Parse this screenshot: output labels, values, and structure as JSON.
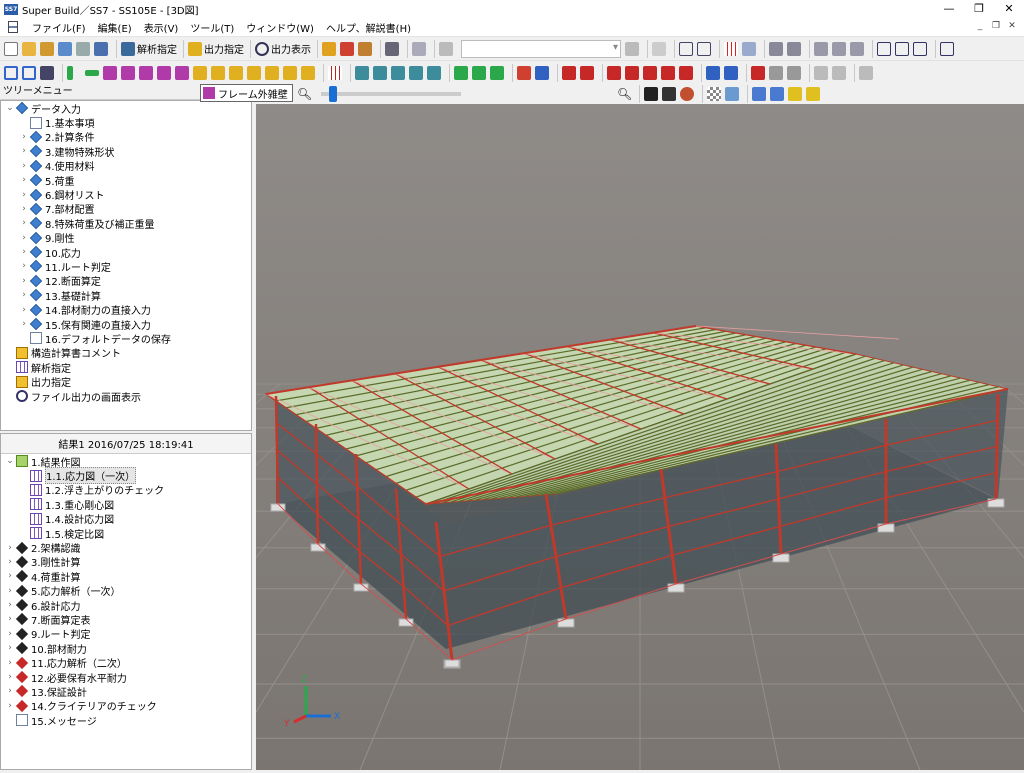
{
  "window": {
    "title": "Super Build／SS7 - SS105E - [3D図]",
    "icon_text": "SS7"
  },
  "menu": [
    "ファイル(F)",
    "編集(E)",
    "表示(V)",
    "ツール(T)",
    "ウィンドウ(W)",
    "ヘルプ、解説書(H)"
  ],
  "toolbar1": {
    "analysis_label": "解析指定",
    "output_label": "出力指定",
    "output_view_label": "出力表示"
  },
  "tooltip": "フレーム外雑壁",
  "tree_header": "ツリーメニュー",
  "tree1": [
    {
      "label": "データ入力",
      "icon": "diamond",
      "exp": "⌄",
      "level": 0
    },
    {
      "label": "1.基本事項",
      "icon": "sheet",
      "exp": "",
      "level": 1
    },
    {
      "label": "2.計算条件",
      "icon": "diamond",
      "exp": "›",
      "level": 1
    },
    {
      "label": "3.建物特殊形状",
      "icon": "diamond",
      "exp": "›",
      "level": 1
    },
    {
      "label": "4.使用材料",
      "icon": "diamond",
      "exp": "›",
      "level": 1
    },
    {
      "label": "5.荷重",
      "icon": "diamond",
      "exp": "›",
      "level": 1
    },
    {
      "label": "6.鋼材リスト",
      "icon": "diamond",
      "exp": "›",
      "level": 1
    },
    {
      "label": "7.部材配置",
      "icon": "diamond",
      "exp": "›",
      "level": 1
    },
    {
      "label": "8.特殊荷重及び補正重量",
      "icon": "diamond",
      "exp": "›",
      "level": 1
    },
    {
      "label": "9.剛性",
      "icon": "diamond",
      "exp": "›",
      "level": 1
    },
    {
      "label": "10.応力",
      "icon": "diamond",
      "exp": "›",
      "level": 1
    },
    {
      "label": "11.ルート判定",
      "icon": "diamond",
      "exp": "›",
      "level": 1
    },
    {
      "label": "12.断面算定",
      "icon": "diamond",
      "exp": "›",
      "level": 1
    },
    {
      "label": "13.基礎計算",
      "icon": "diamond",
      "exp": "›",
      "level": 1
    },
    {
      "label": "14.部材耐力の直接入力",
      "icon": "diamond",
      "exp": "›",
      "level": 1
    },
    {
      "label": "15.保有関連の直接入力",
      "icon": "diamond",
      "exp": "›",
      "level": 1
    },
    {
      "label": "16.デフォルトデータの保存",
      "icon": "sheet",
      "exp": "",
      "level": 1
    },
    {
      "label": "構造計算書コメント",
      "icon": "book",
      "exp": "",
      "level": 0
    },
    {
      "label": "解析指定",
      "icon": "grid",
      "exp": "",
      "level": 0
    },
    {
      "label": "出力指定",
      "icon": "book",
      "exp": "",
      "level": 0
    },
    {
      "label": "ファイル出力の画面表示",
      "icon": "mag",
      "exp": "",
      "level": 0
    }
  ],
  "tree2_header": "結果1  2016/07/25 18:19:41",
  "tree2": [
    {
      "label": "1.結果作図",
      "icon": "check",
      "exp": "⌄",
      "level": 0
    },
    {
      "label": "1.1.応力図（一次）",
      "icon": "grid",
      "exp": "",
      "level": 1,
      "selected": true
    },
    {
      "label": "1.2.浮き上がりのチェック",
      "icon": "grid",
      "exp": "",
      "level": 1
    },
    {
      "label": "1.3.重心剛心図",
      "icon": "grid",
      "exp": "",
      "level": 1
    },
    {
      "label": "1.4.設計応力図",
      "icon": "grid",
      "exp": "",
      "level": 1
    },
    {
      "label": "1.5.検定比図",
      "icon": "grid",
      "exp": "",
      "level": 1
    },
    {
      "label": "2.架構認識",
      "icon": "diamond-b",
      "exp": "›",
      "level": 0
    },
    {
      "label": "3.剛性計算",
      "icon": "diamond-b",
      "exp": "›",
      "level": 0
    },
    {
      "label": "4.荷重計算",
      "icon": "diamond-b",
      "exp": "›",
      "level": 0
    },
    {
      "label": "5.応力解析（一次）",
      "icon": "diamond-b",
      "exp": "›",
      "level": 0
    },
    {
      "label": "6.設計応力",
      "icon": "diamond-b",
      "exp": "›",
      "level": 0
    },
    {
      "label": "7.断面算定表",
      "icon": "diamond-b",
      "exp": "›",
      "level": 0
    },
    {
      "label": "9.ルート判定",
      "icon": "diamond-b",
      "exp": "›",
      "level": 0
    },
    {
      "label": "10.部材耐力",
      "icon": "diamond-b",
      "exp": "›",
      "level": 0
    },
    {
      "label": "11.応力解析（二次）",
      "icon": "diamond-r",
      "exp": "›",
      "level": 0
    },
    {
      "label": "12.必要保有水平耐力",
      "icon": "diamond-r",
      "exp": "›",
      "level": 0
    },
    {
      "label": "13.保証設計",
      "icon": "diamond-r",
      "exp": "›",
      "level": 0
    },
    {
      "label": "14.クライテリアのチェック",
      "icon": "diamond-r",
      "exp": "›",
      "level": 0
    },
    {
      "label": "15.メッセージ",
      "icon": "sheet",
      "exp": "",
      "level": 0
    }
  ],
  "axes": {
    "x": "X",
    "y": "Y",
    "z": "Z"
  },
  "colors": {
    "frame": "#c0392b",
    "roof": "#cfe3b8",
    "purlin": "#5b6b2a",
    "floor": "#2f3d44"
  }
}
